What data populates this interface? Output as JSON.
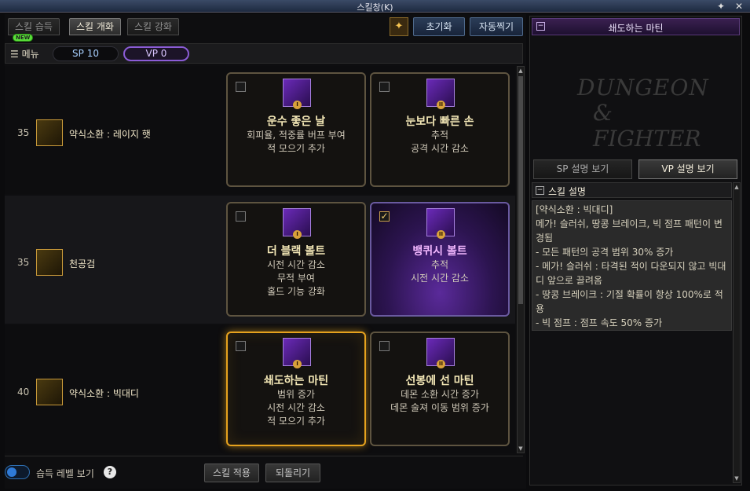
{
  "window": {
    "title": "스킬창(K)"
  },
  "tabs": [
    {
      "label": "스킬 습득",
      "active": false
    },
    {
      "label": "스킬 개화",
      "active": true
    },
    {
      "label": "스킬 강화",
      "active": false
    }
  ],
  "new_badge": "NEW",
  "toolbar": {
    "reset_label": "초기화",
    "auto_label": "자동찍기"
  },
  "menu": {
    "label": "메뉴",
    "sp": "SP 10",
    "vp": "VP 0"
  },
  "rows": [
    {
      "level": "35",
      "skill_name": "약식소환 : 레이지 햇",
      "cards": [
        {
          "title": "운수 좋은 날",
          "desc": [
            "회피율, 적중률 버프 부여",
            "적 모으기 추가"
          ],
          "roman": "I",
          "checked": false,
          "selected": false
        },
        {
          "title": "눈보다 빠른 손",
          "desc": [
            "추적",
            "공격 시간 감소"
          ],
          "roman": "II",
          "checked": false,
          "selected": false
        }
      ]
    },
    {
      "level": "35",
      "skill_name": "천공검",
      "cards": [
        {
          "title": "더 블랙 볼트",
          "desc": [
            "시전 시간 감소",
            "무적 부여",
            "홀드 기능 강화"
          ],
          "roman": "I",
          "checked": false,
          "selected": false
        },
        {
          "title": "뱅퀴시 볼트",
          "desc": [
            "추적",
            "시전 시간 감소"
          ],
          "roman": "II",
          "checked": true,
          "selected": false
        }
      ]
    },
    {
      "level": "40",
      "skill_name": "약식소환 : 빅대디",
      "cards": [
        {
          "title": "쇄도하는 마틴",
          "desc": [
            "범위 증가",
            "시전 시간 감소",
            "적 모으기 추가"
          ],
          "roman": "I",
          "checked": false,
          "selected": true
        },
        {
          "title": "선봉에 선 마틴",
          "desc": [
            "데몬 소환 시간 증가",
            "데몬 술져 이동 범위 증가"
          ],
          "roman": "II",
          "checked": false,
          "selected": false
        }
      ]
    }
  ],
  "bottom": {
    "toggle_label": "습득 레벨 보기",
    "help": "?",
    "apply_label": "스킬 적용",
    "revert_label": "되돌리기"
  },
  "right_panel": {
    "title": "쇄도하는 마틴",
    "logo_line1": "DUNGEON",
    "logo_line2": "& FIGHTER",
    "sp_tab": "SP 설명 보기",
    "vp_tab": "VP 설명 보기",
    "section_title": "스킬 설명",
    "desc_lines": [
      "[약식소환 : 빅대디]",
      "메가! 슬러쉬, 땅콩 브레이크, 빅 점프 패턴이 변경됨",
      " - 모든 패턴의 공격 범위 30% 증가",
      " - 메가! 슬러쉬 : 타격된 적이 다운되지 않고 빅대디 앞으로 끌려옴",
      " - 땅콩 브레이크 : 기절 확률이 항상 100%로 적용",
      " - 빅 점프 : 점프 속도 50% 증가"
    ]
  },
  "colors": {
    "gold": "#e6a21e",
    "vp_purple": "#8b5cd6",
    "sp_blue": "#a8d0ff"
  },
  "icons": [
    "hamburger-icon",
    "pin-icon",
    "close-icon",
    "help-icon",
    "sparkle-icon"
  ]
}
